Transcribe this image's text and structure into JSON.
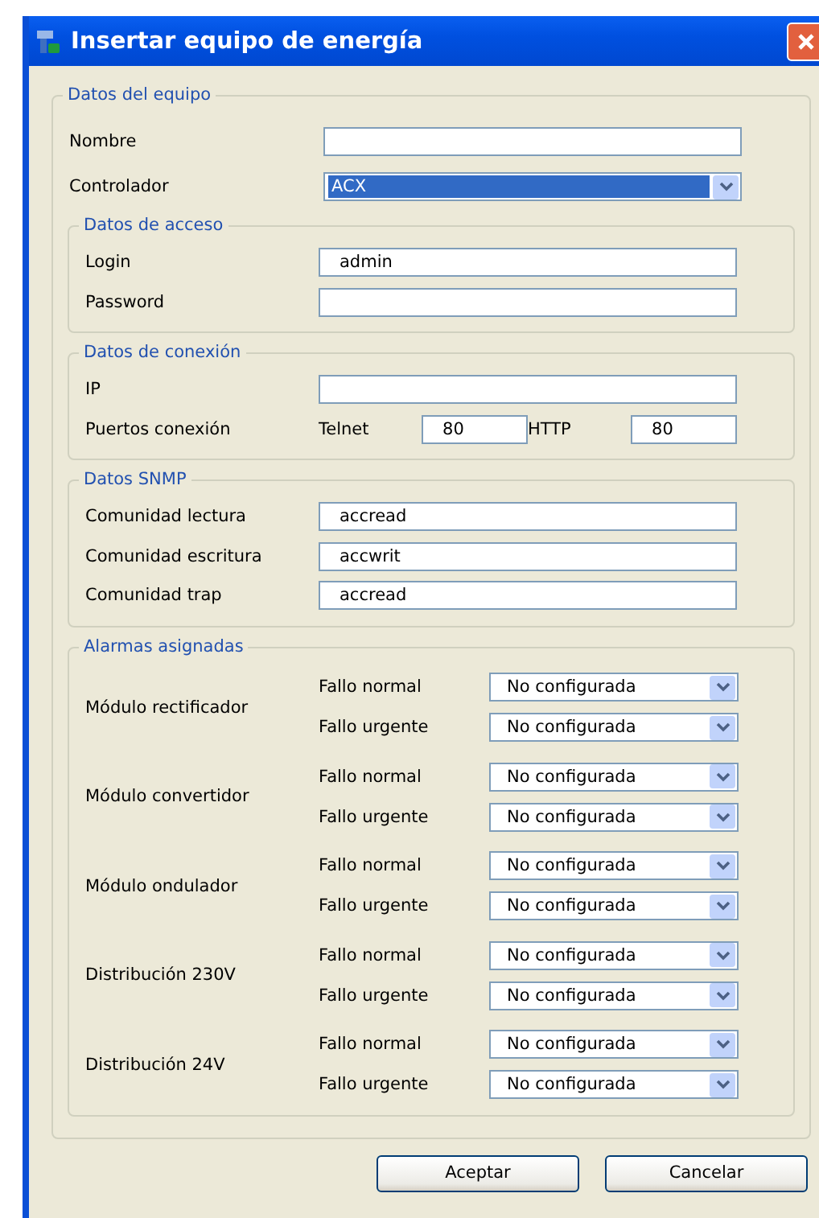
{
  "window": {
    "title": "Insertar equipo de energía"
  },
  "equipment": {
    "legend": "Datos del equipo",
    "fields": [
      {
        "label": "Nombre",
        "kind": "text"
      },
      {
        "label": "Controlador",
        "kind": "select",
        "value": "ACX",
        "highlighted": true
      }
    ],
    "groups": [
      {
        "legend": "Datos de acceso",
        "fields": [
          {
            "label": "Login",
            "kind": "text",
            "value": "admin"
          },
          {
            "label": "Password",
            "kind": "text"
          }
        ]
      },
      {
        "legend": "Datos de conexión",
        "fields": [
          {
            "label": "IP",
            "kind": "text"
          },
          {
            "label": "Puertos conexión",
            "kind": "ports",
            "ports": [
              {
                "label": "Telnet",
                "value": "80"
              },
              {
                "label": "HTTP",
                "value": "80"
              }
            ]
          }
        ]
      },
      {
        "legend": "Datos SNMP",
        "fields": [
          {
            "label": "Comunidad lectura",
            "kind": "text",
            "value": "accread"
          },
          {
            "label": "Comunidad escritura",
            "kind": "text",
            "value": "accwrit"
          },
          {
            "label": "Comunidad trap",
            "kind": "text",
            "value": "accread"
          }
        ]
      },
      {
        "legend": "Alarmas asignadas",
        "alarms": [
          {
            "module": "Módulo rectificador",
            "faults": [
              {
                "label": "Fallo normal",
                "value": "No configurada"
              },
              {
                "label": "Fallo urgente",
                "value": "No configurada"
              }
            ]
          },
          {
            "module": "Módulo convertidor",
            "faults": [
              {
                "label": "Fallo normal",
                "value": "No configurada"
              },
              {
                "label": "Fallo urgente",
                "value": "No configurada"
              }
            ]
          },
          {
            "module": "Módulo ondulador",
            "faults": [
              {
                "label": "Fallo normal",
                "value": "No configurada"
              },
              {
                "label": "Fallo urgente",
                "value": "No configurada"
              }
            ]
          },
          {
            "module": "Distribución 230V",
            "faults": [
              {
                "label": "Fallo normal",
                "value": "No configurada"
              },
              {
                "label": "Fallo urgente",
                "value": "No configurada"
              }
            ]
          },
          {
            "module": "Distribución 24V",
            "faults": [
              {
                "label": "Fallo normal",
                "value": "No configurada"
              },
              {
                "label": "Fallo urgente",
                "value": "No configurada"
              }
            ]
          }
        ]
      }
    ]
  },
  "buttons": [
    "Aceptar",
    "Cancelar"
  ]
}
